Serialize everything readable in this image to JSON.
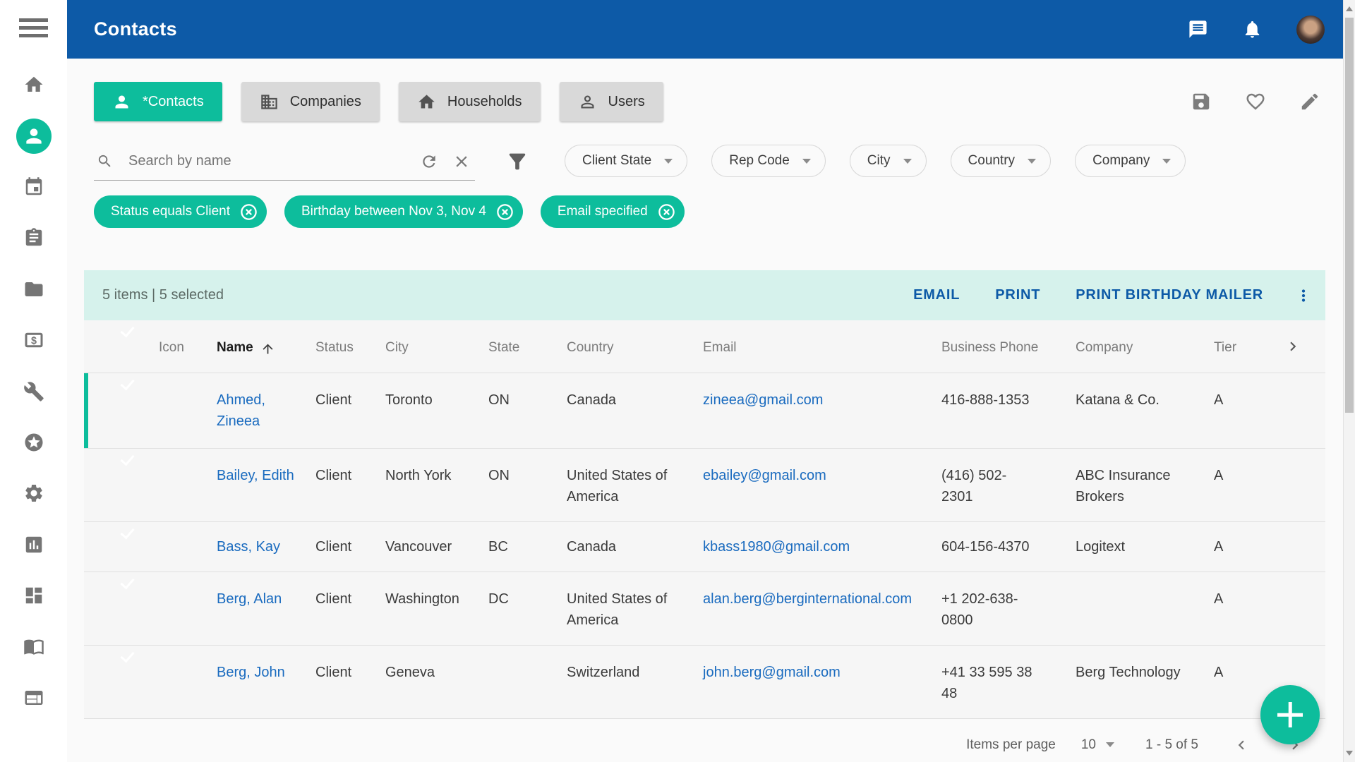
{
  "colors": {
    "primary_blue": "#0d5aa7",
    "accent_teal": "#0dbd9c",
    "selection_bar_bg": "#d6f2ec",
    "link_blue": "#1a6bbf"
  },
  "header": {
    "title": "Contacts",
    "icons": [
      "menu-icon",
      "chat-icon",
      "notifications-icon",
      "user-avatar"
    ]
  },
  "sidebar": {
    "items": [
      {
        "icon": "home-icon"
      },
      {
        "icon": "contacts-icon",
        "active": true
      },
      {
        "icon": "calendar-icon"
      },
      {
        "icon": "tasks-icon"
      },
      {
        "icon": "folder-icon"
      },
      {
        "icon": "billing-icon"
      },
      {
        "icon": "tools-icon"
      },
      {
        "icon": "favorites-icon"
      },
      {
        "icon": "settings-icon"
      },
      {
        "icon": "reports-icon"
      },
      {
        "icon": "dashboard-icon"
      },
      {
        "icon": "library-icon"
      },
      {
        "icon": "cards-icon"
      }
    ]
  },
  "tabs": [
    {
      "label": "*Contacts",
      "icon": "person-icon",
      "active": true
    },
    {
      "label": "Companies",
      "icon": "company-icon",
      "active": false
    },
    {
      "label": "Households",
      "icon": "household-icon",
      "active": false
    },
    {
      "label": "Users",
      "icon": "user-outline-icon",
      "active": false
    }
  ],
  "toolbar": {
    "icons": [
      "save-icon",
      "favorite-icon",
      "edit-icon"
    ]
  },
  "search": {
    "placeholder": "Search by name",
    "value": ""
  },
  "filter_dropdowns": [
    {
      "label": "Client State"
    },
    {
      "label": "Rep Code"
    },
    {
      "label": "City"
    },
    {
      "label": "Country"
    },
    {
      "label": "Company"
    }
  ],
  "filter_chips": [
    {
      "label": "Status equals Client"
    },
    {
      "label": "Birthday between Nov 3, Nov 4"
    },
    {
      "label": "Email specified"
    }
  ],
  "grid": {
    "summary": "5 items | 5 selected",
    "actions": [
      {
        "label": "EMAIL"
      },
      {
        "label": "PRINT"
      },
      {
        "label": "PRINT BIRTHDAY MAILER"
      }
    ],
    "columns": {
      "icon": "Icon",
      "name": "Name",
      "status": "Status",
      "city": "City",
      "state": "State",
      "country": "Country",
      "email": "Email",
      "business_phone": "Business Phone",
      "company": "Company",
      "tier": "Tier"
    },
    "sort": {
      "column": "Name",
      "direction": "ascending"
    },
    "rows": [
      {
        "name": "Ahmed, Zineea",
        "status": "Client",
        "city": "Toronto",
        "state": "ON",
        "country": "Canada",
        "email": "zineea@gmail.com",
        "business_phone": "416-888-1353",
        "company": "Katana & Co.",
        "tier": "A",
        "selected": true
      },
      {
        "name": "Bailey, Edith",
        "status": "Client",
        "city": "North York",
        "state": "ON",
        "country": "United States of America",
        "email": "ebailey@gmail.com",
        "business_phone": "(416) 502-2301",
        "company": "ABC Insurance Brokers",
        "tier": "A",
        "selected": true
      },
      {
        "name": "Bass, Kay",
        "status": "Client",
        "city": "Vancouver",
        "state": "BC",
        "country": "Canada",
        "email": "kbass1980@gmail.com",
        "business_phone": "604-156-4370",
        "company": "Logitext",
        "tier": "A",
        "selected": true
      },
      {
        "name": "Berg, Alan",
        "status": "Client",
        "city": "Washington",
        "state": "DC",
        "country": "United States of America",
        "email": "alan.berg@berginternational.com",
        "business_phone": "+1 202-638-0800",
        "company": "",
        "tier": "A",
        "selected": true
      },
      {
        "name": "Berg, John",
        "status": "Client",
        "city": "Geneva",
        "state": "",
        "country": "Switzerland",
        "email": "john.berg@gmail.com",
        "business_phone": "+41 33 595 38 48",
        "company": "Berg Technology",
        "tier": "A",
        "selected": true
      }
    ]
  },
  "pagination": {
    "items_per_page_label": "Items per page",
    "page_size": "10",
    "range_label": "1 - 5 of 5"
  }
}
